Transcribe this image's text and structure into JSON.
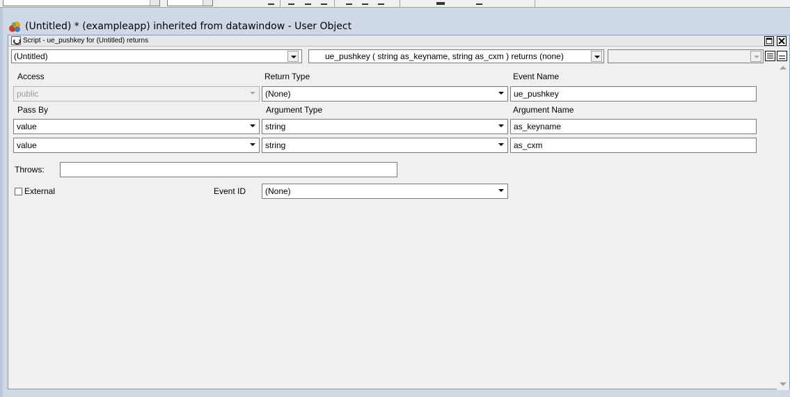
{
  "window": {
    "title": "(Untitled) * (exampleapp) inherited from datawindow - User Object"
  },
  "script": {
    "title": "Script - ue_pushkey for (Untitled) returns",
    "object_select": "(Untitled)",
    "event_select": "ue_pushkey ( string as_keyname, string as_cxm ) returns (none)",
    "ancestor_select": ""
  },
  "form": {
    "access_label": "Access",
    "return_type_label": "Return Type",
    "event_name_label": "Event Name",
    "access_value": "public",
    "return_type_value": "(None)",
    "event_name_value": "ue_pushkey",
    "pass_by_label": "Pass By",
    "argument_type_label": "Argument Type",
    "argument_name_label": "Argument Name",
    "arguments": [
      {
        "pass_by": "value",
        "type": "string",
        "name": "as_keyname"
      },
      {
        "pass_by": "value",
        "type": "string",
        "name": "as_cxm"
      }
    ],
    "throws_label": "Throws:",
    "throws_value": "",
    "external_label": "External",
    "external_checked": false,
    "event_id_label": "Event ID",
    "event_id_value": "(None)"
  },
  "colors": {
    "mdi_background": "#cfd9e6",
    "field_border": "#7a7a7a"
  }
}
